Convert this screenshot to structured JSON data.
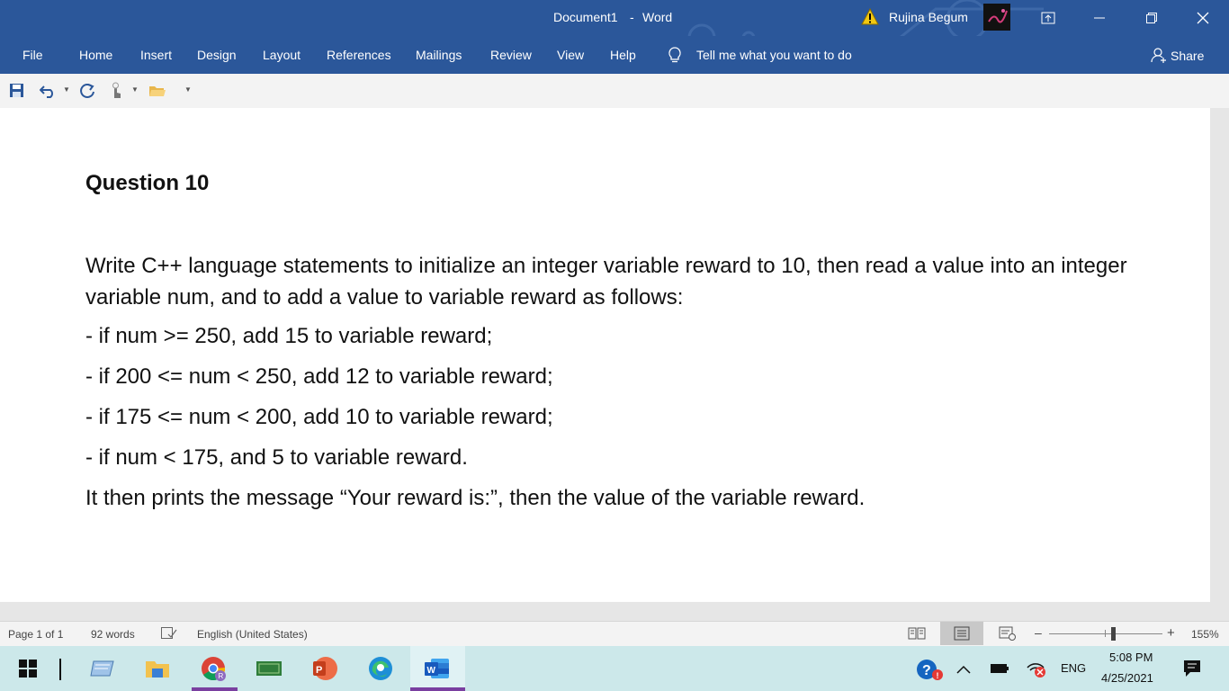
{
  "titlebar": {
    "doc_title": "Document1",
    "separator": "-",
    "app_name": "Word",
    "user_name": "Rujina Begum"
  },
  "ribbon": {
    "tabs": [
      "File",
      "Home",
      "Insert",
      "Design",
      "Layout",
      "References",
      "Mailings",
      "Review",
      "View",
      "Help"
    ],
    "tell_me": "Tell me what you want to do",
    "share": "Share"
  },
  "document": {
    "heading": "Question 10",
    "paragraph1": "Write C++ language statements to initialize an integer variable reward to 10, then read a value into an integer variable num, and to add a value to variable reward as follows:",
    "bullets": [
      "- if num >= 250, add 15 to variable reward;",
      "- if 200 <= num < 250, add 12 to variable reward;",
      "- if 175 <= num < 200, add 10 to variable reward;",
      "- if num < 175, and 5 to variable reward."
    ],
    "closing": "It then prints the message “Your reward is:”, then the value of the variable reward."
  },
  "statusbar": {
    "page": "Page 1 of 1",
    "words": "92 words",
    "language": "English (United States)",
    "zoom_minus": "–",
    "zoom_plus": "+",
    "zoom_level": "155%"
  },
  "taskbar": {
    "language": "ENG",
    "time": "5:08 PM",
    "date": "4/25/2021"
  },
  "colors": {
    "word_blue": "#2b579a",
    "taskbar": "#cce8ea"
  }
}
